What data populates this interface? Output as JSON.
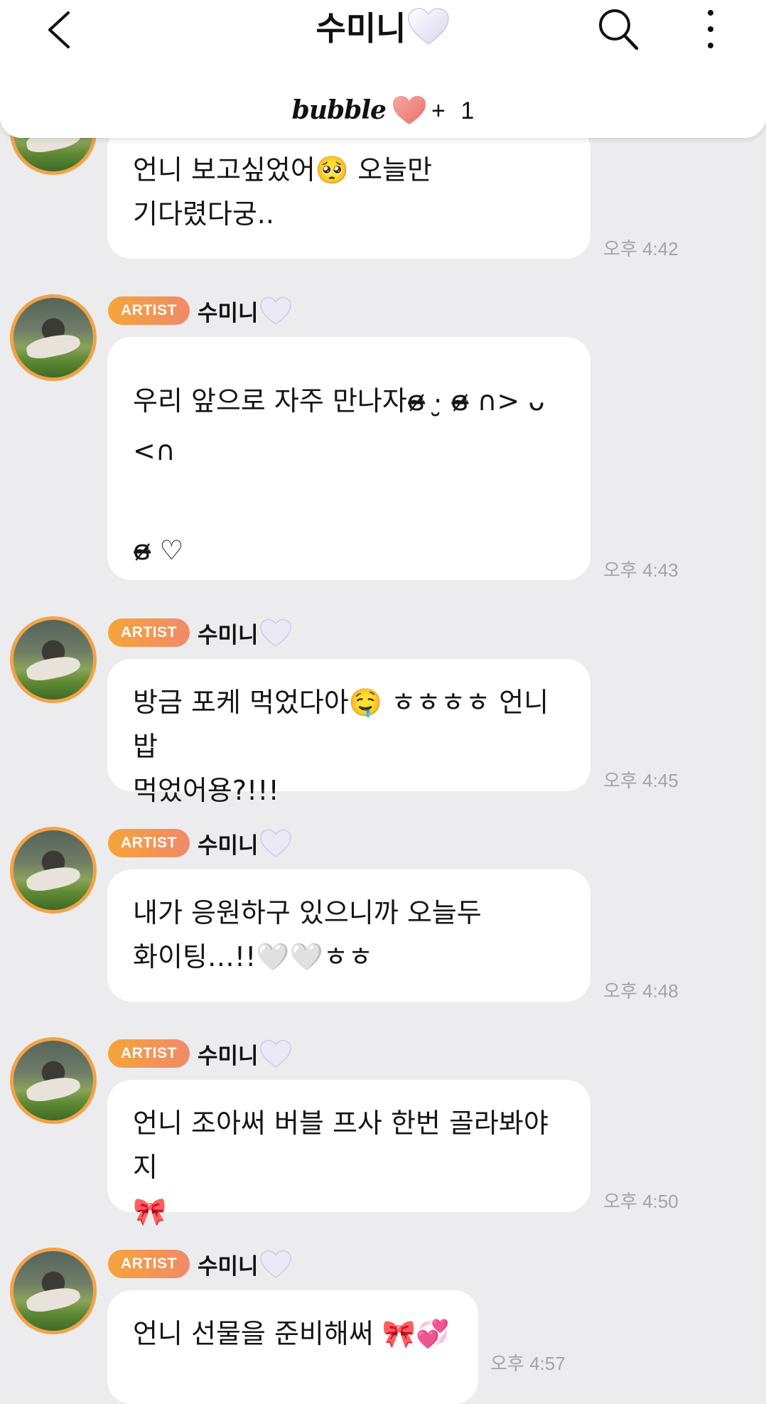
{
  "header": {
    "title": "수미니",
    "bubble_logo": "bubble",
    "bubble_plus": "+",
    "bubble_count": "1"
  },
  "messages": [
    {
      "text": "언니 보고싶었어🥺 오늘만\n기다렸다궁..",
      "time": "오후 4:42"
    },
    {
      "badge": "ARTIST",
      "sender": "수미니",
      "text": "우리 앞으로 자주 만나자ɞ̴̶̷ ·̮ ɞ̴̶̷ ∩> ᴗ <∩\n\nɞ̴̶̷ ♡",
      "time": "오후 4:43"
    },
    {
      "badge": "ARTIST",
      "sender": "수미니",
      "text": "방금 포케 먹었다아🤤 ㅎㅎㅎㅎ 언니 밥\n먹었어용?!!!",
      "time": "오후 4:45"
    },
    {
      "badge": "ARTIST",
      "sender": "수미니",
      "text": "내가 응원하구 있으니까 오늘두\n화이팅…!!🤍🤍ㅎㅎ",
      "time": "오후 4:48"
    },
    {
      "badge": "ARTIST",
      "sender": "수미니",
      "text": "언니 조아써 버블 프사 한번 골라봐야지\n🎀",
      "time": "오후 4:50"
    },
    {
      "badge": "ARTIST",
      "sender": "수미니",
      "text": "언니 선물을 준비해써 🎀💞",
      "time": "오후 4:57"
    }
  ],
  "colors": {
    "accent_orange": "#f2a24a",
    "badge_gradient_start": "#f5a43a",
    "badge_gradient_end": "#f08a6a",
    "background": "#ececee",
    "heart_lavender": "#e6e2f3"
  },
  "icons": {
    "back": "chevron-left-icon",
    "search": "search-icon",
    "more": "more-vertical-icon",
    "title_heart": "white-heart-icon",
    "bubble_heart": "pink-heart-icon"
  }
}
